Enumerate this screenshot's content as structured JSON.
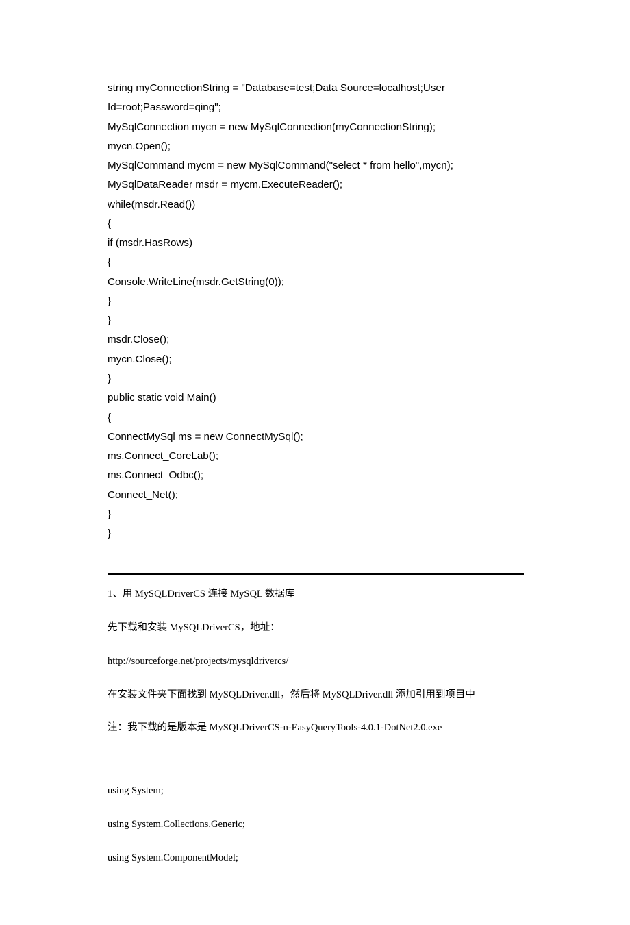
{
  "code": {
    "l1": "string myConnectionString = \"Database=test;Data Source=localhost;User Id=root;Password=qing\";",
    "l2": "MySqlConnection mycn = new MySqlConnection(myConnectionString);",
    "l3": "mycn.Open();",
    "l4": "MySqlCommand mycm = new MySqlCommand(\"select * from hello\",mycn);",
    "l5": "MySqlDataReader msdr = mycm.ExecuteReader();",
    "l6": "while(msdr.Read())",
    "l7": "{",
    "l8": "if (msdr.HasRows)",
    "l9": "{",
    "l10": "Console.WriteLine(msdr.GetString(0));",
    "l11": "}",
    "l12": "}",
    "l13": "msdr.Close();",
    "l14": "mycn.Close();",
    "l15": "}",
    "l16": "public static void Main()",
    "l17": "{",
    "l18": "ConnectMySql ms = new ConnectMySql();",
    "l19": "ms.Connect_CoreLab();",
    "l20": "ms.Connect_Odbc();",
    "l21": "Connect_Net();",
    "l22": "}",
    "l23": "}"
  },
  "text": {
    "p1": "1、用 MySQLDriverCS 连接 MySQL 数据库",
    "p2": "先下载和安装 MySQLDriverCS，地址：",
    "p3": "http://sourceforge.net/projects/mysqldrivercs/",
    "p4": "在安装文件夹下面找到 MySQLDriver.dll，然后将 MySQLDriver.dll 添加引用到项目中",
    "p5": "注：我下载的是版本是  MySQLDriverCS-n-EasyQueryTools-4.0.1-DotNet2.0.exe",
    "p6": "using System;",
    "p7": "using System.Collections.Generic;",
    "p8": "using System.ComponentModel;"
  }
}
